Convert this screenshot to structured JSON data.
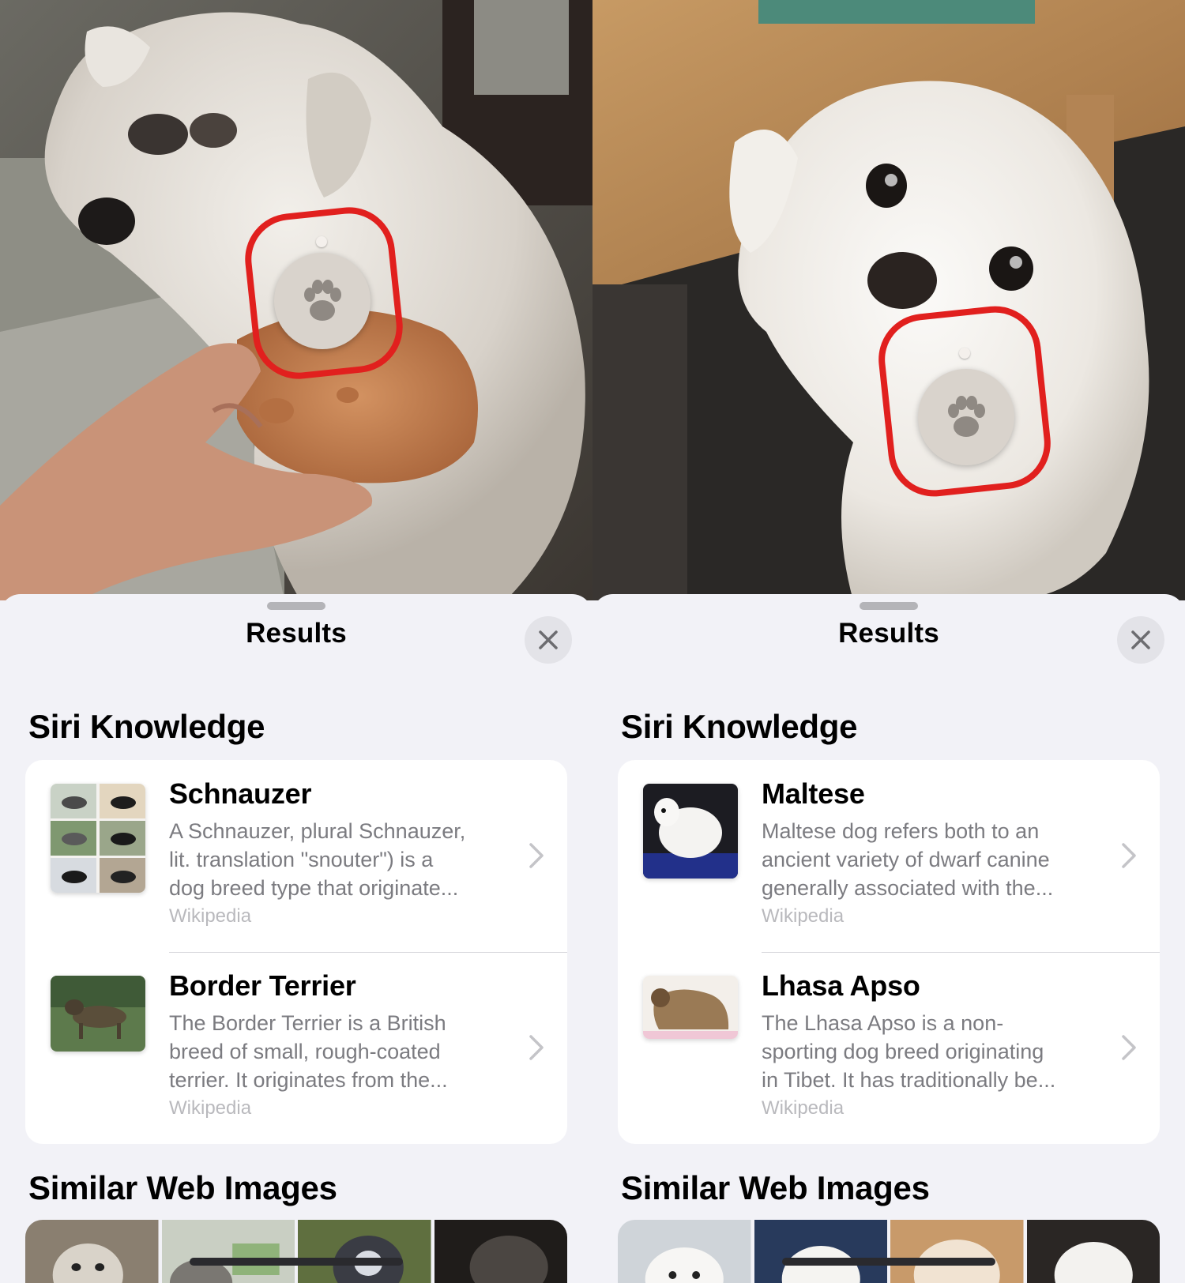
{
  "screens": [
    {
      "results_title": "Results",
      "siri_knowledge_title": "Siri Knowledge",
      "similar_web_images_title": "Similar Web Images",
      "results": [
        {
          "title": "Schnauzer",
          "description_lines": [
            "A Schnauzer, plural Schnauzer,",
            "lit. translation \"snouter\") is a",
            "dog breed type that originate..."
          ],
          "source": "Wikipedia"
        },
        {
          "title": "Border Terrier",
          "description_lines": [
            "The Border Terrier is a British",
            "breed of small, rough-coated",
            "terrier. It originates from the..."
          ],
          "source": "Wikipedia"
        }
      ]
    },
    {
      "results_title": "Results",
      "siri_knowledge_title": "Siri Knowledge",
      "similar_web_images_title": "Similar Web Images",
      "results": [
        {
          "title": "Maltese",
          "description_lines": [
            "Maltese dog refers both to an",
            "ancient variety of dwarf canine",
            "generally associated with the..."
          ],
          "source": "Wikipedia"
        },
        {
          "title": "Lhasa Apso",
          "description_lines": [
            "The Lhasa Apso is a non-",
            "sporting dog breed originating",
            "in Tibet. It has traditionally be..."
          ],
          "source": "Wikipedia"
        }
      ]
    }
  ],
  "icons": {
    "lookup": "paw-icon",
    "close": "close-icon",
    "disclosure": "chevron-right-icon"
  },
  "colors": {
    "annotation_ring": "#e1201e",
    "sheet_background": "#f2f2f7",
    "card_background": "#ffffff",
    "secondary_text": "#7b7b80",
    "tertiary_text": "#b9b9bd"
  }
}
